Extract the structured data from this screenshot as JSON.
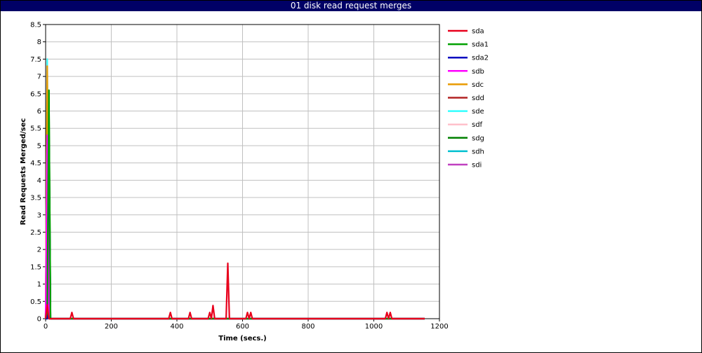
{
  "chart_data": {
    "type": "line",
    "title": "01 disk read request merges",
    "xlabel": "Time (secs.)",
    "ylabel": "Read Requests Merged/sec",
    "xlim": [
      0,
      1200
    ],
    "ylim": [
      0,
      8.5
    ],
    "x_ticks": [
      0,
      200,
      400,
      600,
      800,
      1000,
      1200
    ],
    "y_ticks": [
      0,
      0.5,
      1,
      1.5,
      2,
      2.5,
      3,
      3.5,
      4,
      4.5,
      5,
      5.5,
      6,
      6.5,
      7,
      7.5,
      8,
      8.5
    ],
    "grid": true,
    "legend_position": "right",
    "series": [
      {
        "name": "sda",
        "color": "#e8001c",
        "x": [
          0,
          5,
          10,
          15,
          75,
          80,
          85,
          375,
          380,
          385,
          435,
          440,
          445,
          495,
          500,
          505,
          510,
          515,
          520,
          550,
          555,
          560,
          565,
          610,
          615,
          620,
          625,
          630,
          1035,
          1040,
          1045,
          1050,
          1055,
          1155
        ],
        "y": [
          0,
          0.4,
          0,
          0,
          0,
          0.18,
          0,
          0,
          0.18,
          0,
          0,
          0.18,
          0,
          0,
          0.18,
          0,
          0.38,
          0,
          0,
          0,
          1.6,
          0,
          0,
          0,
          0.18,
          0,
          0.18,
          0,
          0,
          0.18,
          0,
          0.18,
          0,
          0
        ]
      },
      {
        "name": "sda1",
        "color": "#00a000",
        "x": [
          0,
          5,
          10,
          15,
          1155
        ],
        "y": [
          0,
          0.2,
          6.6,
          0,
          0
        ]
      },
      {
        "name": "sda2",
        "color": "#0000c0",
        "x": [
          0,
          5,
          10,
          15,
          1155
        ],
        "y": [
          0,
          0,
          5.6,
          0,
          0
        ]
      },
      {
        "name": "sdb",
        "color": "#ff00ff",
        "x": [
          0,
          5,
          10,
          15,
          1155
        ],
        "y": [
          0,
          5.3,
          0,
          0,
          0
        ]
      },
      {
        "name": "sdc",
        "color": "#e89a00",
        "x": [
          0,
          5,
          10,
          15,
          1155
        ],
        "y": [
          0,
          7.3,
          0,
          0,
          0
        ]
      },
      {
        "name": "sdd",
        "color": "#b22222",
        "x": [
          0,
          5,
          10,
          15,
          1155
        ],
        "y": [
          0,
          6.2,
          0,
          0,
          0
        ]
      },
      {
        "name": "sde",
        "color": "#33ffff",
        "x": [
          0,
          5,
          10,
          15,
          1155
        ],
        "y": [
          0,
          7.5,
          0,
          0,
          0
        ]
      },
      {
        "name": "sdf",
        "color": "#ffc0cb",
        "x": [
          0,
          5,
          10,
          15,
          1155
        ],
        "y": [
          0,
          4.2,
          0,
          0,
          0
        ]
      },
      {
        "name": "sdg",
        "color": "#008000",
        "x": [
          0,
          5,
          10,
          15,
          1155
        ],
        "y": [
          0,
          0,
          6.6,
          0,
          0
        ]
      },
      {
        "name": "sdh",
        "color": "#00c0d0",
        "x": [
          0,
          5,
          10,
          15,
          1155
        ],
        "y": [
          0,
          0.3,
          5.3,
          0,
          0
        ]
      },
      {
        "name": "sdi",
        "color": "#c040c0",
        "x": [
          0,
          5,
          10,
          15,
          1155
        ],
        "y": [
          0,
          5.4,
          0,
          0,
          0
        ]
      }
    ]
  }
}
